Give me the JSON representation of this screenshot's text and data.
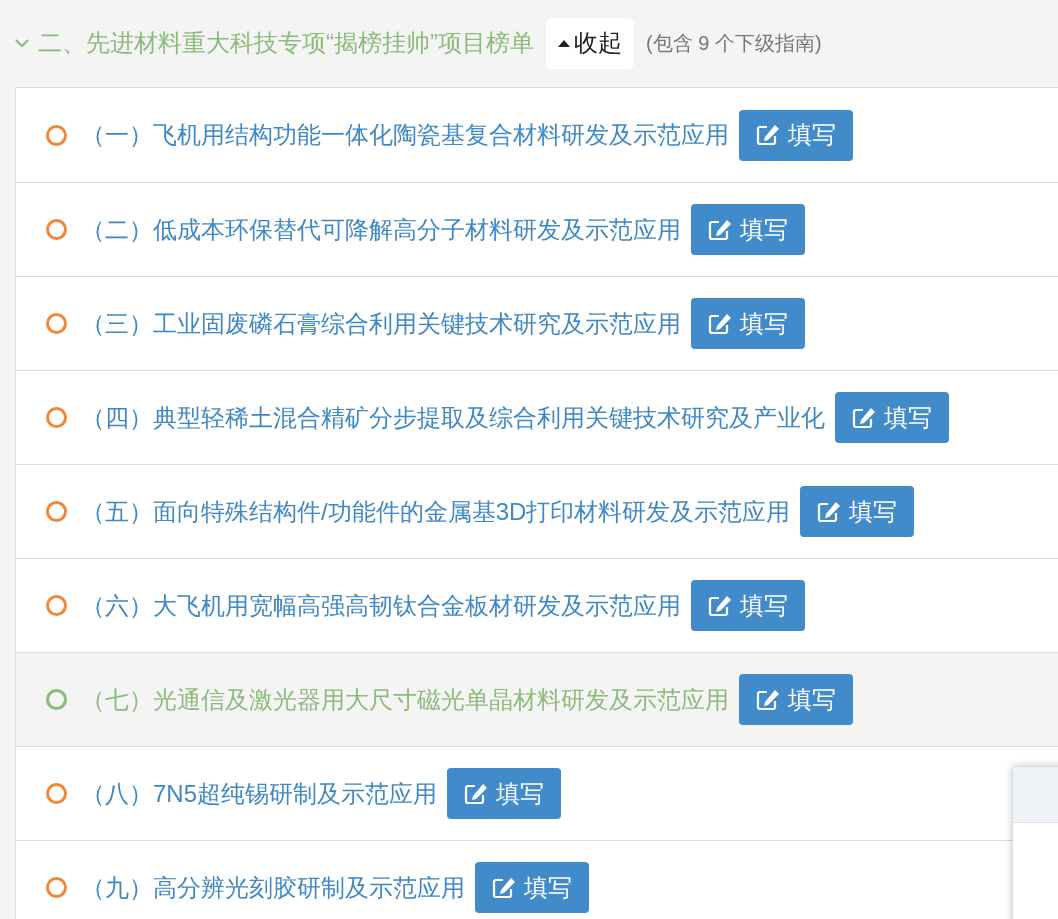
{
  "section": {
    "title": "二、先进材料重大科技专项“揭榜挂帅”项目榜单",
    "expanded": true,
    "toggle_label": "收起",
    "summary": "(包含 9 个下级指南)"
  },
  "items": [
    {
      "label": "（一）飞机用结构功能一体化陶瓷基复合材料研发及示范应用",
      "selected": false,
      "button": "填写"
    },
    {
      "label": "（二）低成本环保替代可降解高分子材料研发及示范应用",
      "selected": false,
      "button": "填写"
    },
    {
      "label": "（三）工业固废磷石膏综合利用关键技术研究及示范应用",
      "selected": false,
      "button": "填写"
    },
    {
      "label": "（四）典型轻稀土混合精矿分步提取及综合利用关键技术研究及产业化",
      "selected": false,
      "button": "填写"
    },
    {
      "label": "（五）面向特殊结构件/功能件的金属基3D打印材料研发及示范应用",
      "selected": false,
      "button": "填写"
    },
    {
      "label": "（六）大飞机用宽幅高强高韧钛合金板材研发及示范应用",
      "selected": false,
      "button": "填写"
    },
    {
      "label": "（七）光通信及激光器用大尺寸磁光单晶材料研发及示范应用",
      "selected": true,
      "button": "填写"
    },
    {
      "label": "（八）7N5超纯锡研制及示范应用",
      "selected": false,
      "button": "填写"
    },
    {
      "label": "（九）高分辨光刻胶研制及示范应用",
      "selected": false,
      "button": "填写"
    }
  ]
}
